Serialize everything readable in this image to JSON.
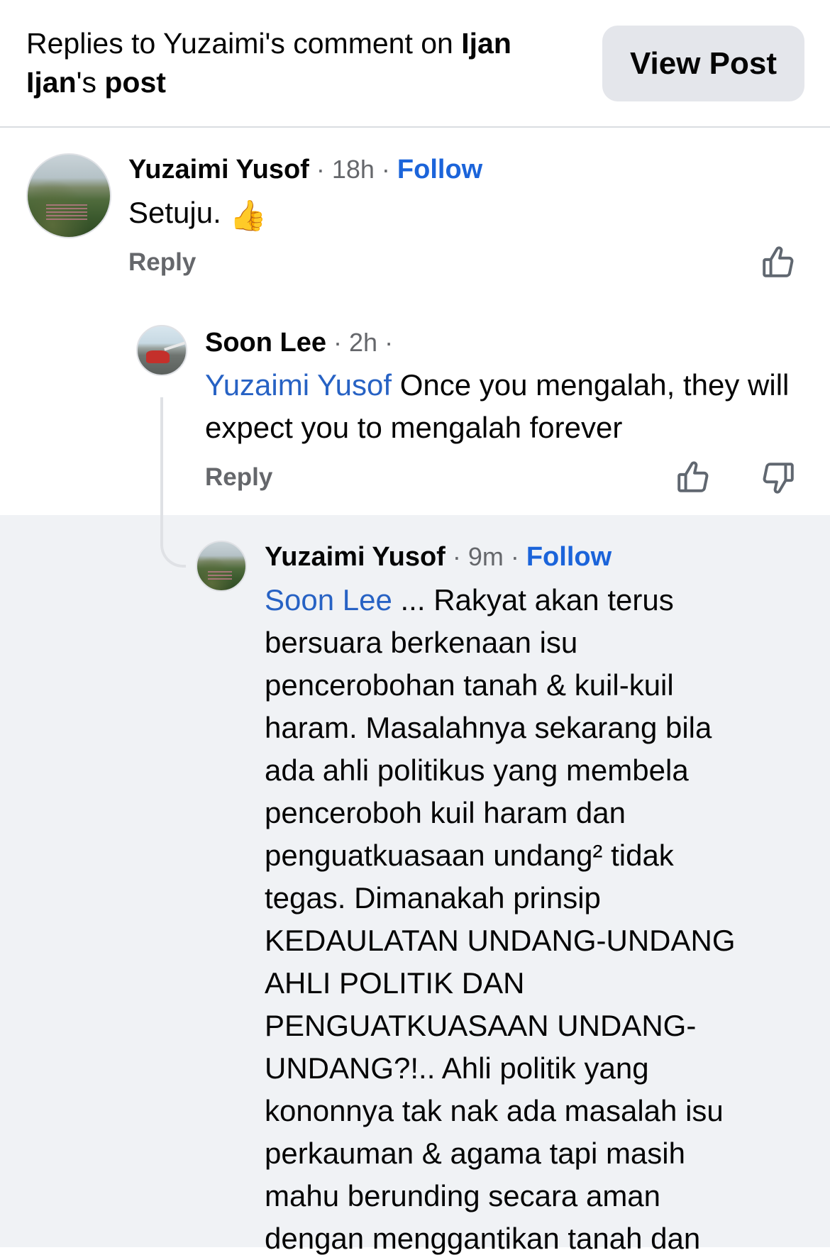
{
  "header": {
    "prefix": "Replies to Yuzaimi's comment on ",
    "name_part1": "Ijan",
    "name_part2": "Ijan",
    "possessive": "'s ",
    "post_word": "post",
    "view_post_label": "View Post"
  },
  "comments": [
    {
      "author": "Yuzaimi Yusof",
      "time": " · 18h · ",
      "follow": "Follow",
      "text": "Setuju. ",
      "emoji": "👍",
      "reply_label": "Reply"
    },
    {
      "author": "Soon Lee",
      "time": " · 2h ·",
      "mention": "Yuzaimi Yusof",
      "text": " Once you mengalah, they will expect you to mengalah forever",
      "reply_label": "Reply"
    },
    {
      "author": "Yuzaimi Yusof",
      "time": " · 9m · ",
      "follow": "Follow",
      "mention": "Soon Lee",
      "lines": [
        " ... Rakyat akan terus",
        "bersuara berkenaan isu",
        "pencerobohan tanah & kuil-kuil",
        "haram. Masalahnya sekarang bila",
        "ada ahli politikus yang membela",
        "penceroboh kuil haram dan",
        "penguatkuasaan undang² tidak",
        "tegas. Dimanakah prinsip",
        "KEDAULATAN UNDANG-UNDANG",
        "AHLI POLITIK DAN",
        "PENGUATKUASAAN UNDANG-",
        "UNDANG?!.. Ahli politik yang",
        "kononnya tak nak ada masalah isu",
        "perkauman & agama tapi masih",
        "mahu berunding secara aman",
        "dengan menggantikan tanah dan"
      ]
    }
  ],
  "icons": {
    "like": "thumbs-up-outline",
    "dislike": "thumbs-down-outline",
    "emoji": "thumbs-up-emoji"
  },
  "colors": {
    "mention": "#2762c4",
    "follow": "#1b64da",
    "meta": "#65676b",
    "highlight_bg": "#f0f2f5",
    "button_bg": "#e4e6eb"
  }
}
